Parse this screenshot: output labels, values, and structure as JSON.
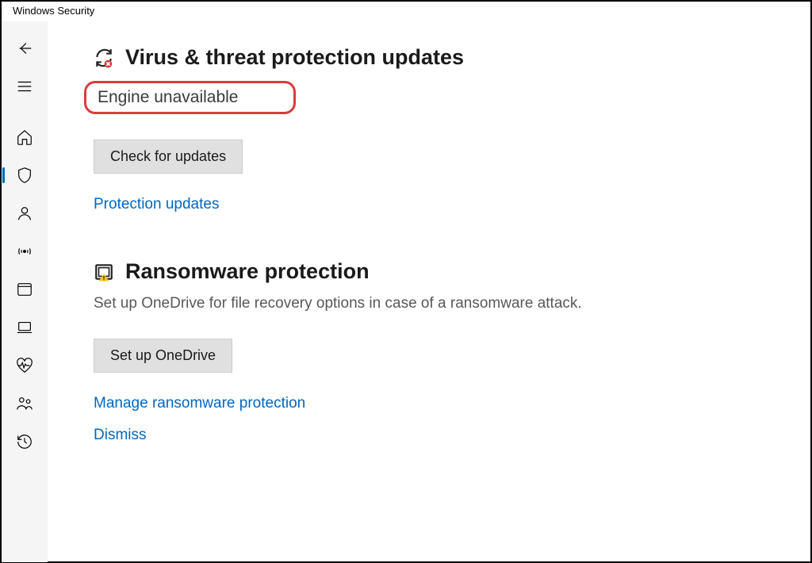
{
  "window": {
    "title": "Windows Security"
  },
  "sections": {
    "virus": {
      "title": "Virus & threat protection updates",
      "status": "Engine unavailable",
      "check_btn": "Check for updates",
      "protection_link": "Protection updates"
    },
    "ransomware": {
      "title": "Ransomware protection",
      "description": "Set up OneDrive for file recovery options in case of a ransomware attack.",
      "setup_btn": "Set up OneDrive",
      "manage_link": "Manage ransomware protection",
      "dismiss_link": "Dismiss"
    }
  }
}
